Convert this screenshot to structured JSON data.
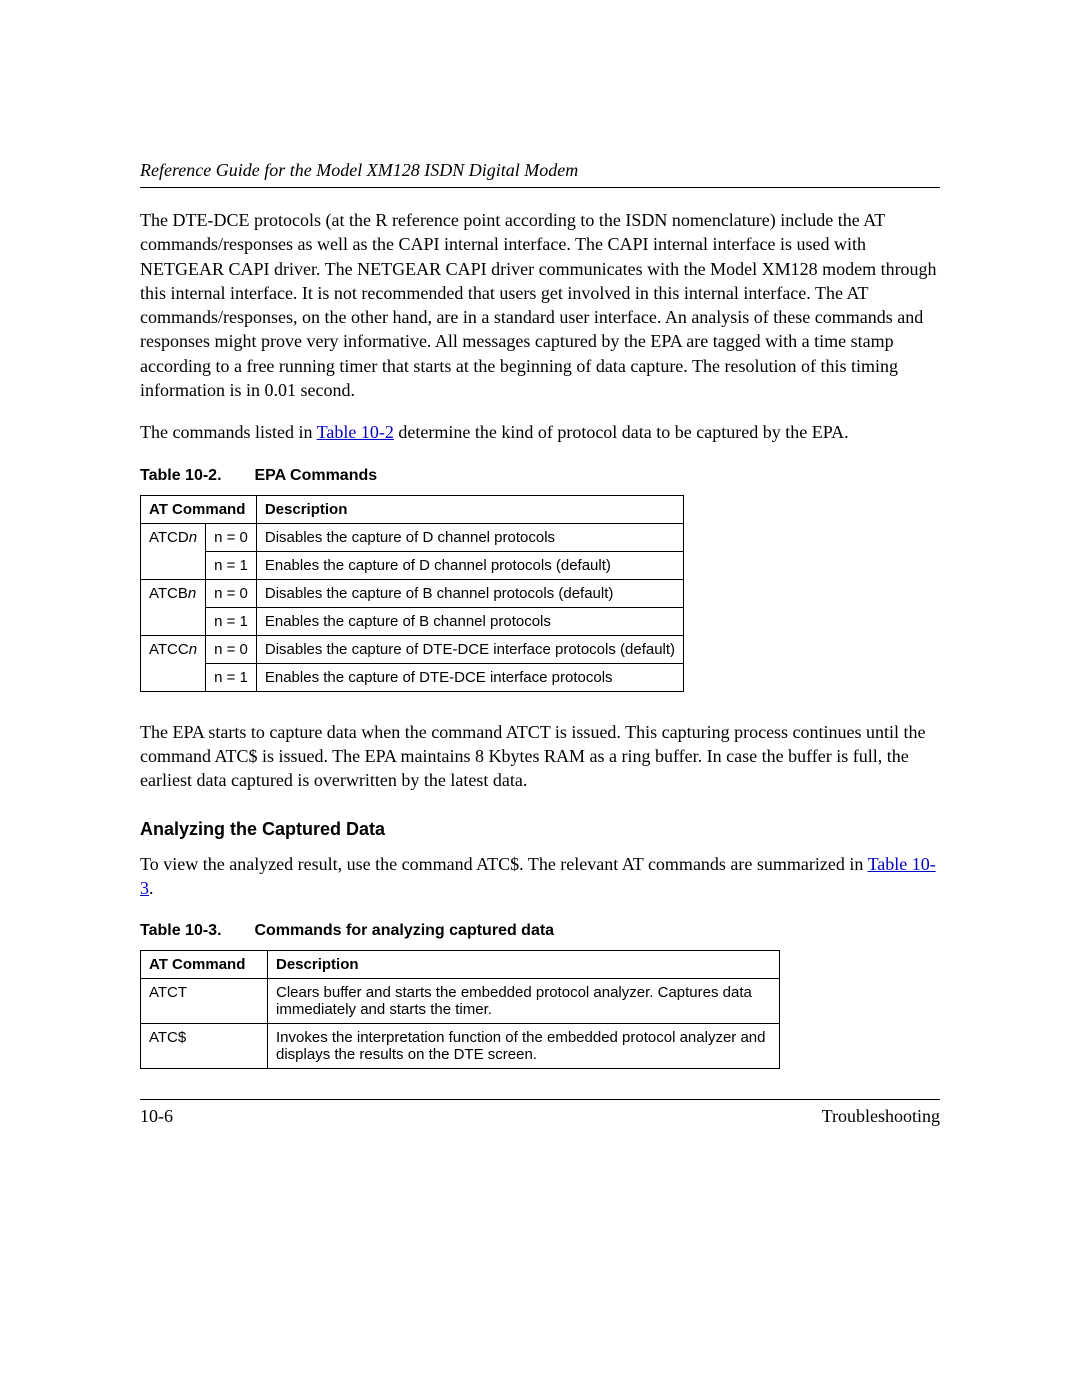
{
  "header": {
    "title": "Reference Guide for the Model XM128 ISDN Digital Modem"
  },
  "paragraphs": {
    "p1": "The DTE-DCE protocols (at the R reference point according to the ISDN nomenclature) include the AT commands/responses as well as the CAPI internal interface. The CAPI internal interface is used with NETGEAR CAPI driver. The NETGEAR CAPI driver communicates with the Model XM128 modem through this internal interface. It is not recommended that users get involved in this internal interface. The AT commands/responses, on the other hand, are in a standard user interface. An analysis of these commands and responses might prove very informative. All messages captured by the EPA are tagged with a time stamp according to a free running timer that starts at the beginning of data capture. The resolution of this timing information is in 0.01 second.",
    "p2_prefix": "The commands listed in ",
    "p2_link": "Table 10-2",
    "p2_suffix": " determine the kind of protocol data to be captured by the EPA.",
    "p3": "The EPA starts to capture data when the command ATCT is issued. This capturing process continues until the command ATC$ is issued. The EPA maintains 8 Kbytes RAM as a ring buffer. In case the buffer is full, the earliest data captured is overwritten by the latest data.",
    "p4_prefix": "To view the analyzed result, use the command ATC$. The relevant AT commands are summarized in ",
    "p4_link": "Table 10-3",
    "p4_suffix": "."
  },
  "section_heading": "Analyzing the Captured Data",
  "table1": {
    "caption_label": "Table 10-2.",
    "caption_title": "EPA Commands",
    "headers": {
      "c1": "AT Command",
      "c2": "Description"
    },
    "rows": [
      {
        "cmd_prefix": "ATCD",
        "cmd_suffix": "n",
        "cond": "n = 0",
        "desc": "Disables the capture of D channel protocols"
      },
      {
        "cond": "n = 1",
        "desc": "Enables the capture of D channel protocols (default)"
      },
      {
        "cmd_prefix": "ATCB",
        "cmd_suffix": "n",
        "cond": "n = 0",
        "desc": "Disables the capture of B channel protocols (default)"
      },
      {
        "cond": "n = 1",
        "desc": "Enables the capture of B channel protocols"
      },
      {
        "cmd_prefix": "ATCC",
        "cmd_suffix": "n",
        "cond": "n = 0",
        "desc": "Disables the capture of DTE-DCE interface protocols (default)"
      },
      {
        "cond": "n = 1",
        "desc": "Enables the capture of DTE-DCE interface protocols"
      }
    ]
  },
  "table2": {
    "caption_label": "Table 10-3.",
    "caption_title": "Commands for analyzing captured data",
    "headers": {
      "c1": "AT Command",
      "c2": "Description"
    },
    "rows": [
      {
        "cmd": "ATCT",
        "desc": "Clears buffer and starts the embedded protocol analyzer. Captures data immediately and starts the timer."
      },
      {
        "cmd": "ATC$",
        "desc": "Invokes the interpretation function of the embedded protocol analyzer and displays the results on the DTE screen."
      }
    ]
  },
  "footer": {
    "left": "10-6",
    "right": "Troubleshooting"
  }
}
